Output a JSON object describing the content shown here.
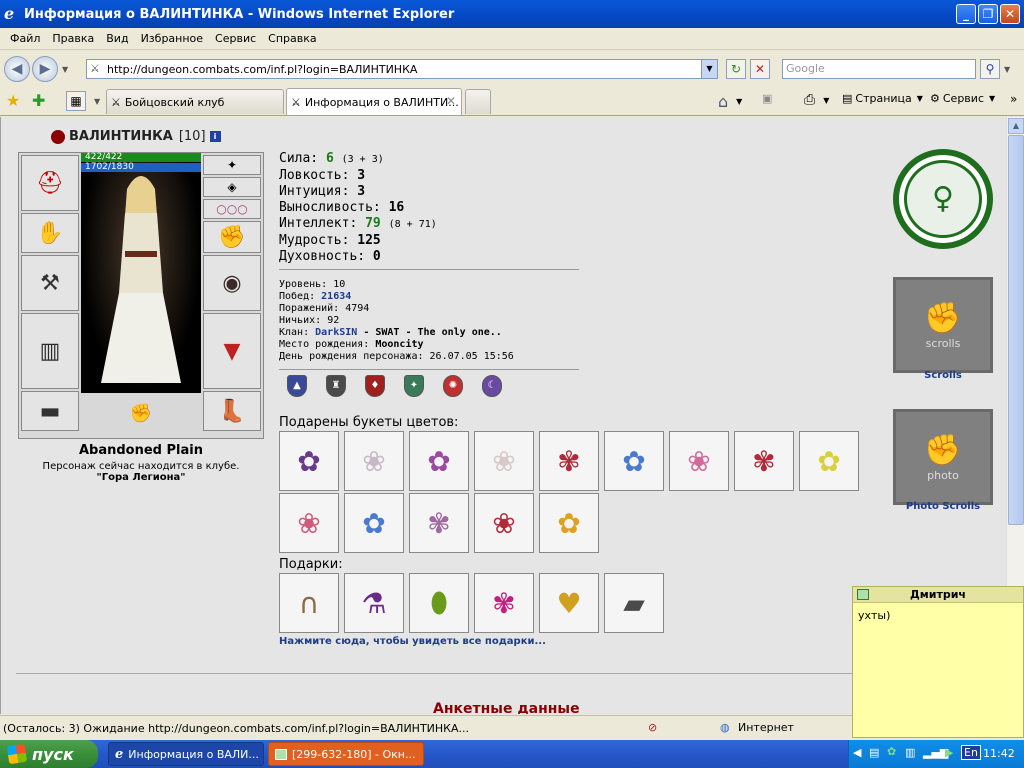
{
  "window": {
    "title": "Информация о ВАЛИНТИНКА - Windows Internet Explorer"
  },
  "menu": [
    "Файл",
    "Правка",
    "Вид",
    "Избранное",
    "Сервис",
    "Справка"
  ],
  "address": {
    "url": "http://dungeon.combats.com/inf.pl?login=ВАЛИНТИНКА",
    "search_placeholder": "Google"
  },
  "tabs": [
    {
      "label": "Бойцовский клуб",
      "active": false
    },
    {
      "label": "Информация о ВАЛИНТИ...",
      "active": true
    }
  ],
  "toolbar_right": {
    "page_label": "Страница",
    "tools_label": "Сервис"
  },
  "character": {
    "name": "ВАЛИНТИНКА",
    "level_tag": "[10]",
    "info_icon": "i",
    "hp": "422/422",
    "mana": "1702/1830",
    "location": "Abandoned Plain",
    "location_note": "Персонаж сейчас находится в клубе.",
    "location_place": "\"Гора Легиона\""
  },
  "stats": [
    {
      "label": "Сила:",
      "value": "6",
      "extra": "(3 + 3)",
      "green": true
    },
    {
      "label": "Ловкость:",
      "value": "3",
      "extra": "",
      "green": false
    },
    {
      "label": "Интуиция:",
      "value": "3",
      "extra": "",
      "green": false
    },
    {
      "label": "Выносливость:",
      "value": "16",
      "extra": "",
      "green": false
    },
    {
      "label": "Интеллект:",
      "value": "79",
      "extra": "(8 + 71)",
      "green": true
    },
    {
      "label": "Мудрость:",
      "value": "125",
      "extra": "",
      "green": false
    },
    {
      "label": "Духовность:",
      "value": "0",
      "extra": "",
      "green": false
    }
  ],
  "info": {
    "level": {
      "label": "Уровень:",
      "value": "10"
    },
    "wins": {
      "label": "Побед:",
      "value": "21634"
    },
    "losses": {
      "label": "Поражений:",
      "value": "4794"
    },
    "draws": {
      "label": "Ничьих:",
      "value": "92"
    },
    "clan": {
      "label": "Клан:",
      "name": "DarkSIN",
      "desc": "- SWAT - The only one.."
    },
    "birthplace": {
      "label": "Место рождения:",
      "value": "Mooncity"
    },
    "birthday": {
      "label": "День рождения персонажа:",
      "value": "26.07.05 15:56"
    }
  },
  "flowers_title": "Подарены букеты цветов:",
  "gifts_title": "Подарки:",
  "gifts_link": "Нажмите сюда, чтобы увидеть все подарки...",
  "anket_title": "Анкетные данные",
  "side": {
    "scrolls_label": "Scrolls",
    "scrolls_inner": "scrolls",
    "photo_label": "Photo Scrolls",
    "photo_inner": "photo"
  },
  "popup": {
    "sender": "Дмитрич",
    "message": "ухты)"
  },
  "status": {
    "text": "(Осталось: 3) Ожидание http://dungeon.combats.com/inf.pl?login=ВАЛИНТИНКА...",
    "zone": "Интернет"
  },
  "taskbar": {
    "start_label": "пуск",
    "tasks": [
      "Информация о ВАЛИ...",
      "[299-632-180] - Окн..."
    ],
    "lang": "En",
    "clock": "11:42"
  }
}
